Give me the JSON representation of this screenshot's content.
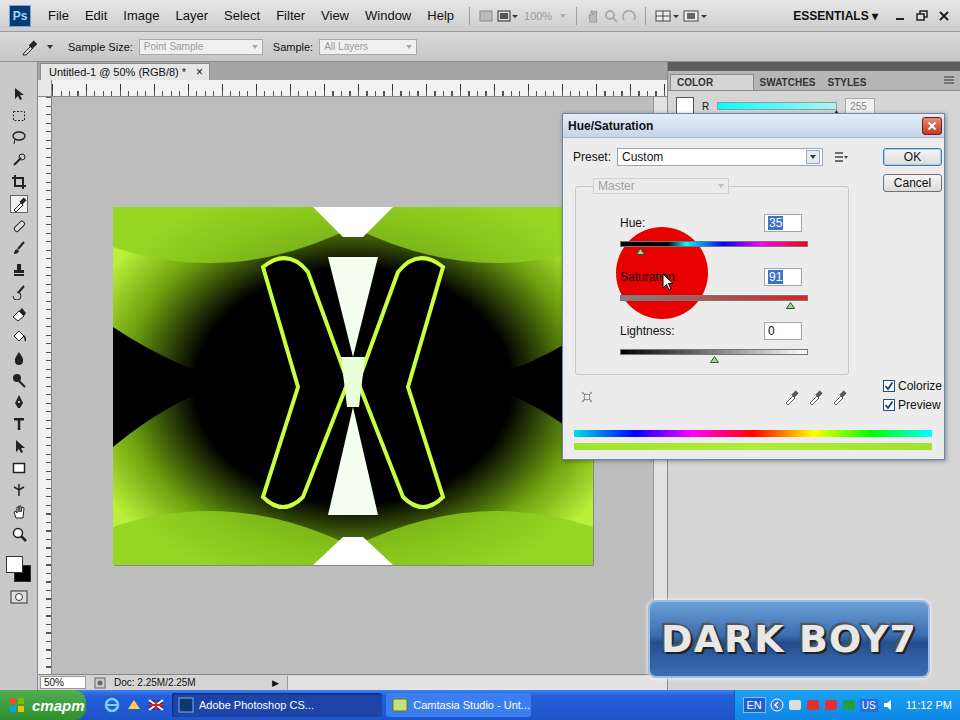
{
  "app": {
    "logo": "Ps",
    "menus": [
      "File",
      "Edit",
      "Image",
      "Layer",
      "Select",
      "Filter",
      "View",
      "Window",
      "Help"
    ],
    "zoom": "100%",
    "workspace": "ESSENTIALS ▾"
  },
  "options": {
    "sample_size_label": "Sample Size:",
    "sample_size": "Point Sample",
    "sample_label": "Sample:",
    "sample": "All Layers"
  },
  "document": {
    "title": "Untitled-1 @ 50% (RGB/8) *",
    "close": "×",
    "zoom": "50%",
    "info": "Doc: 2.25M/2.25M",
    "arrow": "▶"
  },
  "panel": {
    "tabs": [
      {
        "label": "COLOR",
        "selected": true
      },
      {
        "label": "SWATCHES",
        "selected": false
      },
      {
        "label": "STYLES",
        "selected": false
      }
    ],
    "channel": "R",
    "value": "255",
    "level": 1
  },
  "dialog": {
    "title": "Hue/Saturation",
    "preset_label": "Preset:",
    "preset": "Custom",
    "edit": "Master",
    "edit_disabled": true,
    "sliders": [
      {
        "label": "Hue:",
        "value": "35",
        "highlighted": true,
        "level": 0.1,
        "kind": "hue"
      },
      {
        "label": "Saturation:",
        "value": "91",
        "highlighted": true,
        "level": 0.91,
        "kind": "saturation"
      },
      {
        "label": "Lightness:",
        "value": "0",
        "highlighted": false,
        "level": 0.5,
        "kind": "lightness"
      }
    ],
    "checkboxes": [
      {
        "label": "Colorize",
        "checked": true
      },
      {
        "label": "Preview",
        "checked": true
      }
    ],
    "buttons": [
      {
        "label": "OK",
        "default": true
      },
      {
        "label": "Cancel",
        "default": false
      }
    ]
  },
  "watermark": "DARK BOY7",
  "taskbar": {
    "start": "старт",
    "tasks": [
      {
        "label": "Adobe Photoshop CS...",
        "selected": true
      },
      {
        "label": "Camtasia Studio - Unt...",
        "selected": false
      }
    ],
    "lang": "EN",
    "tray": "US",
    "clock": "11:12 PM"
  }
}
